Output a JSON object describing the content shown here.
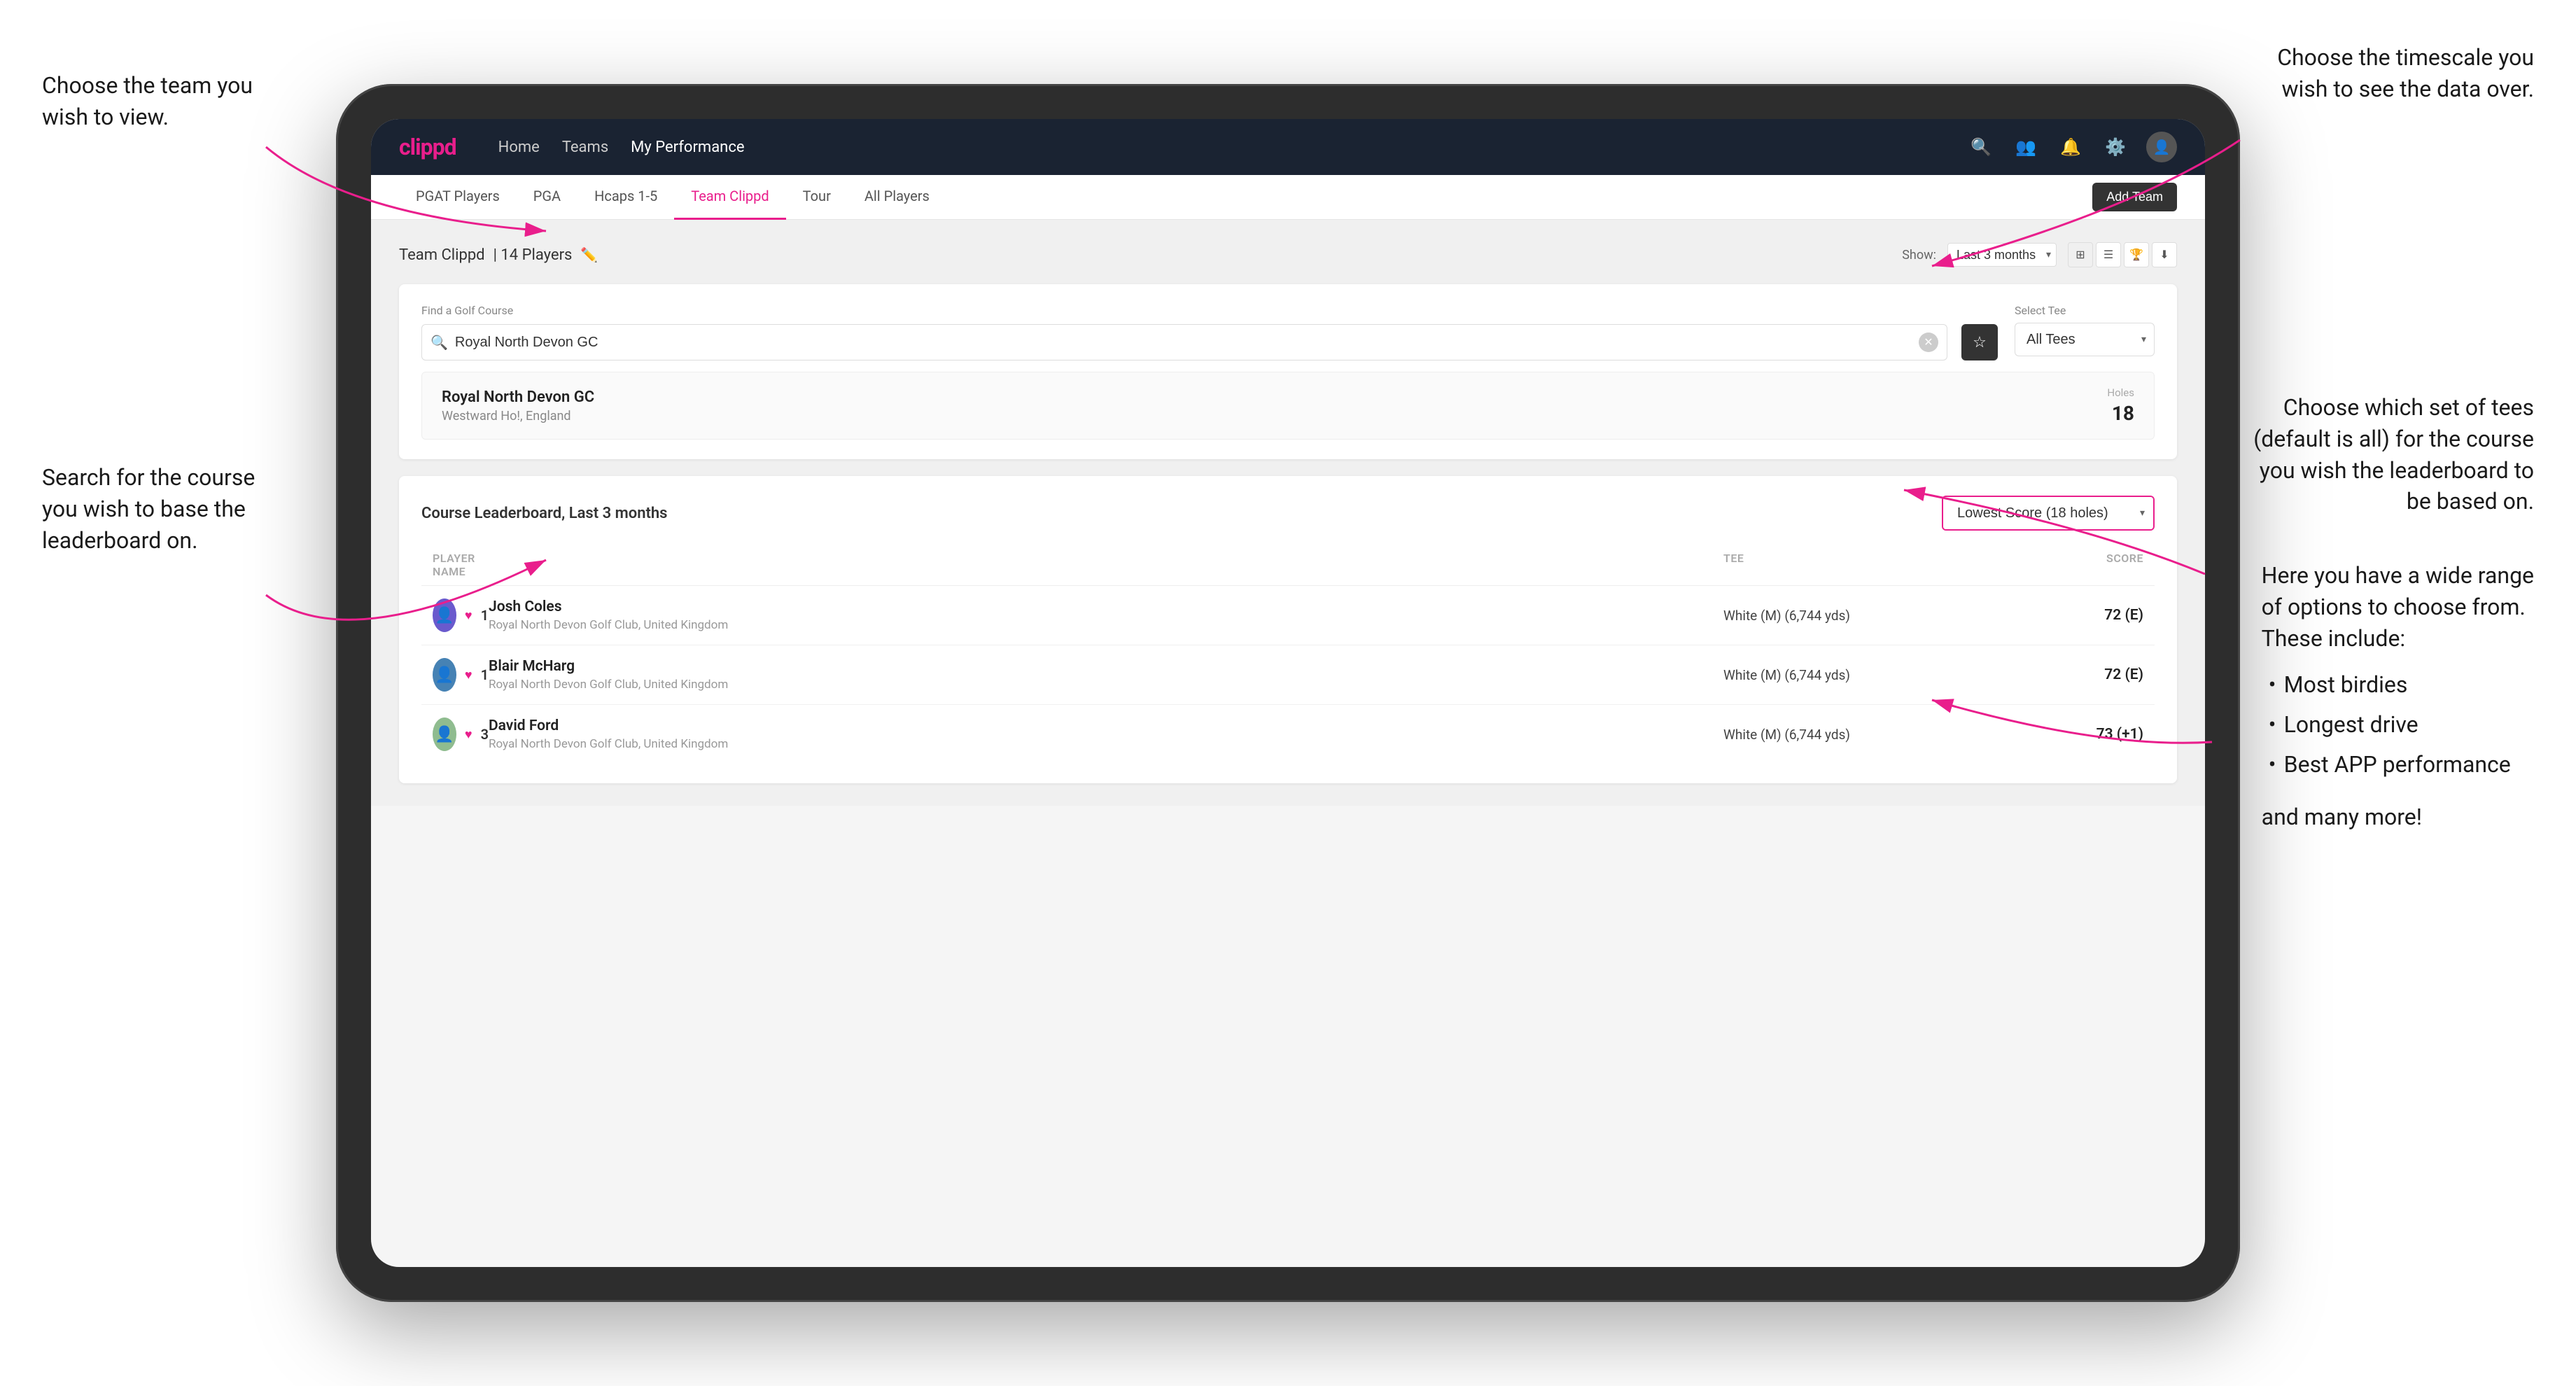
{
  "annotations": {
    "top_left": {
      "line1": "Choose the team you",
      "line2": "wish to view."
    },
    "bottom_left": {
      "line1": "Search for the course",
      "line2": "you wish to base the",
      "line3": "leaderboard on."
    },
    "top_right": {
      "line1": "Choose the timescale you",
      "line2": "wish to see the data over."
    },
    "middle_right": {
      "line1": "Choose which set of tees",
      "line2": "(default is all) for the course",
      "line3": "you wish the leaderboard to",
      "line4": "be based on."
    },
    "options_right": {
      "line1": "Here you have a wide range",
      "line2": "of options to choose from.",
      "line3": "These include:",
      "bullets": [
        "Most birdies",
        "Longest drive",
        "Best APP performance"
      ],
      "and_more": "and many more!"
    }
  },
  "navbar": {
    "logo": "clippd",
    "links": [
      "Home",
      "Teams",
      "My Performance"
    ],
    "active_link": "My Performance"
  },
  "sub_nav": {
    "items": [
      "PGAT Players",
      "PGA",
      "Hcaps 1-5",
      "Team Clippd",
      "Tour",
      "All Players"
    ],
    "active": "Team Clippd",
    "add_team_btn": "Add Team"
  },
  "team_header": {
    "title": "Team Clippd",
    "player_count": "14 Players",
    "show_label": "Show:",
    "show_value": "Last 3 months"
  },
  "course_finder": {
    "find_label": "Find a Golf Course",
    "search_value": "Royal North Devon GC",
    "select_tee_label": "Select Tee",
    "tee_value": "All Tees"
  },
  "course_result": {
    "name": "Royal North Devon GC",
    "location": "Westward Ho!, England",
    "holes_label": "Holes",
    "holes_value": "18"
  },
  "leaderboard": {
    "title": "Course Leaderboard,",
    "period": "Last 3 months",
    "dropdown_value": "Lowest Score (18 holes)",
    "columns": {
      "player": "PLAYER NAME",
      "tee": "TEE",
      "score": "SCORE"
    },
    "players": [
      {
        "rank": "1",
        "name": "Josh Coles",
        "club": "Royal North Devon Golf Club, United Kingdom",
        "tee": "White (M) (6,744 yds)",
        "score": "72 (E)",
        "avatar_color": "#6a5acd"
      },
      {
        "rank": "1",
        "name": "Blair McHarg",
        "club": "Royal North Devon Golf Club, United Kingdom",
        "tee": "White (M) (6,744 yds)",
        "score": "72 (E)",
        "avatar_color": "#4682b4"
      },
      {
        "rank": "3",
        "name": "David Ford",
        "club": "Royal North Devon Golf Club, United Kingdom",
        "tee": "White (M) (6,744 yds)",
        "score": "73 (+1)",
        "avatar_color": "#8fbc8f"
      }
    ]
  }
}
